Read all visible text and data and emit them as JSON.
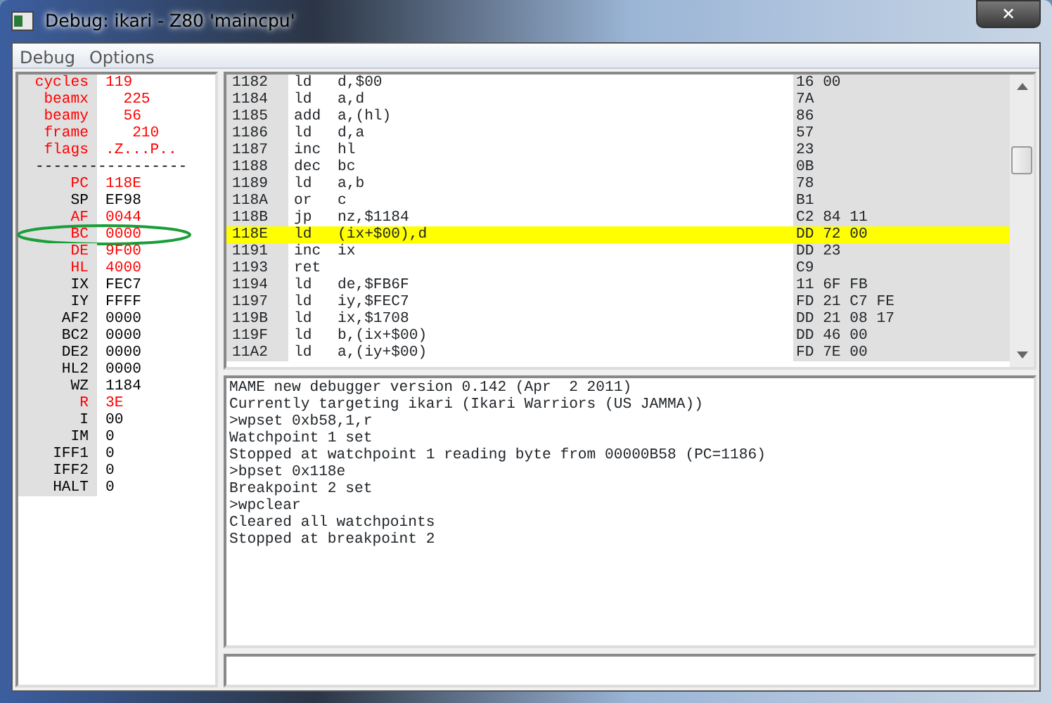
{
  "window": {
    "title": "Debug: ikari - Z80 'maincpu'",
    "close": "✕"
  },
  "menu": [
    "Debug",
    "Options"
  ],
  "state": {
    "stats": [
      {
        "name": "cycles",
        "value": "119"
      },
      {
        "name": "beamx",
        "value": "  225"
      },
      {
        "name": "beamy",
        "value": "  56"
      },
      {
        "name": "frame",
        "value": "   210"
      },
      {
        "name": "flags",
        "value": ".Z...P.."
      }
    ],
    "divider": "-----------------",
    "registers": [
      {
        "name": "PC",
        "value": "118E",
        "changed": true,
        "circled": false
      },
      {
        "name": "SP",
        "value": "EF98",
        "changed": false,
        "circled": false
      },
      {
        "name": "AF",
        "value": "0044",
        "changed": true,
        "circled": false
      },
      {
        "name": "BC",
        "value": "0000",
        "changed": true,
        "circled": true
      },
      {
        "name": "DE",
        "value": "9F00",
        "changed": true,
        "circled": false
      },
      {
        "name": "HL",
        "value": "4000",
        "changed": true,
        "circled": false
      },
      {
        "name": "IX",
        "value": "FEC7",
        "changed": false,
        "circled": false
      },
      {
        "name": "IY",
        "value": "FFFF",
        "changed": false,
        "circled": false
      },
      {
        "name": "AF2",
        "value": "0000",
        "changed": false,
        "circled": false
      },
      {
        "name": "BC2",
        "value": "0000",
        "changed": false,
        "circled": false
      },
      {
        "name": "DE2",
        "value": "0000",
        "changed": false,
        "circled": false
      },
      {
        "name": "HL2",
        "value": "0000",
        "changed": false,
        "circled": false
      },
      {
        "name": "WZ",
        "value": "1184",
        "changed": false,
        "circled": false
      },
      {
        "name": "R",
        "value": "3E",
        "changed": true,
        "circled": false
      },
      {
        "name": "I",
        "value": "00",
        "changed": false,
        "circled": false
      },
      {
        "name": "IM",
        "value": "0",
        "changed": false,
        "circled": false
      },
      {
        "name": "IFF1",
        "value": "0",
        "changed": false,
        "circled": false
      },
      {
        "name": "IFF2",
        "value": "0",
        "changed": false,
        "circled": false
      },
      {
        "name": "HALT",
        "value": "0",
        "changed": false,
        "circled": false
      }
    ]
  },
  "disassembly": [
    {
      "address": "1182",
      "mnemonic": "ld",
      "operands": "d,$00",
      "bytes": "16 00",
      "selected": false
    },
    {
      "address": "1184",
      "mnemonic": "ld",
      "operands": "a,d",
      "bytes": "7A",
      "selected": false
    },
    {
      "address": "1185",
      "mnemonic": "add",
      "operands": "a,(hl)",
      "bytes": "86",
      "selected": false
    },
    {
      "address": "1186",
      "mnemonic": "ld",
      "operands": "d,a",
      "bytes": "57",
      "selected": false
    },
    {
      "address": "1187",
      "mnemonic": "inc",
      "operands": "hl",
      "bytes": "23",
      "selected": false
    },
    {
      "address": "1188",
      "mnemonic": "dec",
      "operands": "bc",
      "bytes": "0B",
      "selected": false
    },
    {
      "address": "1189",
      "mnemonic": "ld",
      "operands": "a,b",
      "bytes": "78",
      "selected": false
    },
    {
      "address": "118A",
      "mnemonic": "or",
      "operands": "c",
      "bytes": "B1",
      "selected": false
    },
    {
      "address": "118B",
      "mnemonic": "jp",
      "operands": "nz,$1184",
      "bytes": "C2 84 11",
      "selected": false
    },
    {
      "address": "118E",
      "mnemonic": "ld",
      "operands": "(ix+$00),d",
      "bytes": "DD 72 00",
      "selected": true
    },
    {
      "address": "1191",
      "mnemonic": "inc",
      "operands": "ix",
      "bytes": "DD 23",
      "selected": false
    },
    {
      "address": "1193",
      "mnemonic": "ret",
      "bytes": "C9",
      "selected": false
    },
    {
      "address": "1194",
      "mnemonic": "ld",
      "operands": "de,$FB6F",
      "bytes": "11 6F FB",
      "selected": false
    },
    {
      "address": "1197",
      "mnemonic": "ld",
      "operands": "iy,$FEC7",
      "bytes": "FD 21 C7 FE",
      "selected": false
    },
    {
      "address": "119B",
      "mnemonic": "ld",
      "operands": "ix,$1708",
      "bytes": "DD 21 08 17",
      "selected": false
    },
    {
      "address": "119F",
      "mnemonic": "ld",
      "operands": "b,(ix+$00)",
      "bytes": "DD 46 00",
      "selected": false
    },
    {
      "address": "11A2",
      "mnemonic": "ld",
      "operands": "a,(iy+$00)",
      "bytes": "FD 7E 00",
      "selected": false
    }
  ],
  "console": [
    "MAME new debugger version 0.142 (Apr  2 2011)",
    "Currently targeting ikari (Ikari Warriors (US JAMMA))",
    ">wpset 0xb58,1,r",
    "Watchpoint 1 set",
    "Stopped at watchpoint 1 reading byte from 00000B58 (PC=1186)",
    ">bpset 0x118e",
    "Breakpoint 2 set",
    ">wpclear",
    "Cleared all watchpoints",
    "Stopped at breakpoint 2"
  ]
}
